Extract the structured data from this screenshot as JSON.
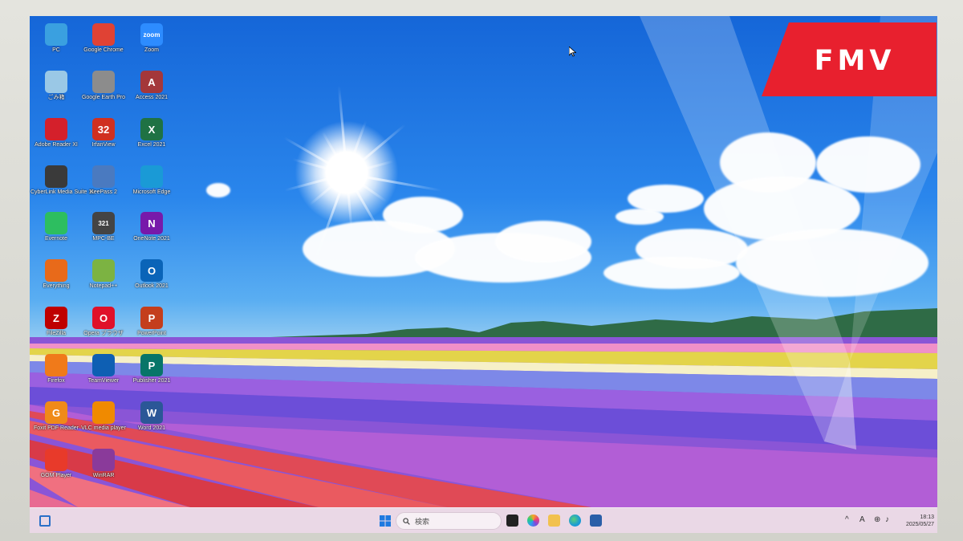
{
  "desktop": {
    "icons": [
      {
        "label": "PC",
        "icon": "monitor-icon",
        "color": "#3aa0e0"
      },
      {
        "label": "Google Chrome",
        "icon": "chrome-icon",
        "color": "#e04234"
      },
      {
        "label": "Zoom",
        "icon": "zoom-icon",
        "color": "#2d8cff",
        "text": "zoom"
      },
      {
        "label": "ごみ箱",
        "icon": "recycle-bin-icon",
        "color": "#9ac8e6"
      },
      {
        "label": "Google Earth Pro",
        "icon": "google-earth-icon",
        "color": "#8c8c8c"
      },
      {
        "label": "Access 2021",
        "icon": "access-icon",
        "color": "#a4373a",
        "text": "A"
      },
      {
        "label": "Adobe Reader XI",
        "icon": "adobe-reader-icon",
        "color": "#d4202b"
      },
      {
        "label": "IrfanView",
        "icon": "irfanview-icon",
        "color": "#d03020",
        "text": "32"
      },
      {
        "label": "Excel 2021",
        "icon": "excel-icon",
        "color": "#1f7244",
        "text": "X"
      },
      {
        "label": "CyberLink Media Suite 11",
        "icon": "cyberlink-icon",
        "color": "#3a3a3a"
      },
      {
        "label": "KeePass 2",
        "icon": "keepass-icon",
        "color": "#4a7ac0"
      },
      {
        "label": "Microsoft Edge",
        "icon": "edge-icon",
        "color": "#1a9ad6"
      },
      {
        "label": "Evernote",
        "icon": "evernote-icon",
        "color": "#2dbe60"
      },
      {
        "label": "MPC-BE",
        "icon": "media-player-icon",
        "color": "#444444",
        "text": "321"
      },
      {
        "label": "OneNote 2021",
        "icon": "onenote-icon",
        "color": "#7719aa",
        "text": "N"
      },
      {
        "label": "Everything",
        "icon": "everything-icon",
        "color": "#e86a1a"
      },
      {
        "label": "Notepad++",
        "icon": "notepadpp-icon",
        "color": "#7cb342"
      },
      {
        "label": "Outlook 2021",
        "icon": "outlook-icon",
        "color": "#0a64b8",
        "text": "O"
      },
      {
        "label": "FileZilla",
        "icon": "filezilla-icon",
        "color": "#bf0000",
        "text": "Z"
      },
      {
        "label": "Opera ブラウザ",
        "icon": "opera-icon",
        "color": "#e0102a",
        "text": "O"
      },
      {
        "label": "PowerPoint",
        "icon": "powerpoint-icon",
        "color": "#c43e1c",
        "text": "P"
      },
      {
        "label": "Firefox",
        "icon": "firefox-icon",
        "color": "#f07a1a"
      },
      {
        "label": "TeamViewer",
        "icon": "teamviewer-icon",
        "color": "#0e5fb3"
      },
      {
        "label": "Publisher 2021",
        "icon": "publisher-icon",
        "color": "#077568",
        "text": "P"
      },
      {
        "label": "Foxit PDF Reader",
        "icon": "foxit-icon",
        "color": "#f08a18",
        "text": "G"
      },
      {
        "label": "VLC media player",
        "icon": "vlc-icon",
        "color": "#f08a00"
      },
      {
        "label": "Word 2021",
        "icon": "word-icon",
        "color": "#2b5797",
        "text": "W"
      },
      {
        "label": "GOM Player",
        "icon": "gom-player-icon",
        "color": "#e83a2a"
      },
      {
        "label": "WinRAR",
        "icon": "winrar-icon",
        "color": "#8a3a9a"
      }
    ]
  },
  "brand": {
    "logo_text": "FMV",
    "logo_color": "#e8202e"
  },
  "taskbar": {
    "search_placeholder": "検索",
    "clock_time": "18:13",
    "clock_date": "2025/05/27",
    "tray_icons": [
      "chevron-up-icon",
      "input-indicator-icon",
      "network-icon",
      "volume-icon"
    ],
    "input_indicator": "A"
  }
}
